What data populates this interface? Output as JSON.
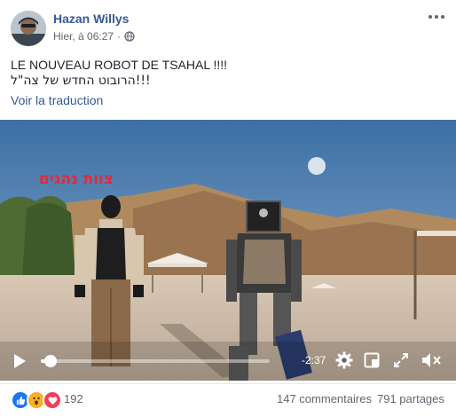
{
  "post": {
    "author": "Hazan Willys",
    "timestamp": "Hier, à 06:27",
    "privacy_icon": "globe-icon",
    "line1": "LE NOUVEAU ROBOT DE TSAHAL !!!!",
    "line2": "!!!הרובוט החדש של צה\"ל",
    "translate_link": "Voir la traduction"
  },
  "video": {
    "overlay_caption": "צוות נהגים",
    "time_remaining": "-2:37",
    "progress_fraction": 0.02,
    "controls": [
      "play-icon",
      "settings-icon",
      "theater-icon",
      "fullscreen-icon",
      "volume-muted-icon"
    ]
  },
  "footer": {
    "reaction_types": [
      "like",
      "wow",
      "love"
    ],
    "reaction_count": "192",
    "comments": "147 commentaires",
    "shares": "791 partages"
  },
  "colors": {
    "link": "#385898",
    "like": "#1877f2",
    "wow": "#f7b125",
    "love": "#f33e58",
    "caption": "#e8273a"
  }
}
